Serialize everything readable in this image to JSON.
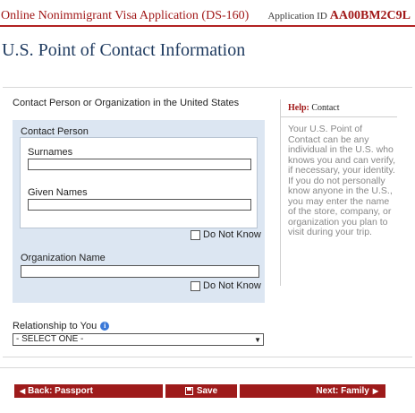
{
  "header": {
    "app_title": "Online Nonimmigrant Visa Application (DS-160)",
    "app_id_label": "Application ID",
    "app_id_value": "AA00BM2C9L"
  },
  "page": {
    "title": "U.S. Point of Contact Information"
  },
  "form": {
    "section_title": "Contact Person or Organization in the United States",
    "contact_person_legend": "Contact Person",
    "surnames_label": "Surnames",
    "surnames_value": "",
    "given_names_label": "Given Names",
    "given_names_value": "",
    "do_not_know_label": "Do Not Know",
    "organization_label": "Organization Name",
    "organization_value": "",
    "relationship_label": "Relationship to You",
    "relationship_selected": "- SELECT ONE -"
  },
  "help": {
    "heading": "Help:",
    "topic": "Contact",
    "text": "Your U.S. Point of Contact can be any individual in the U.S. who knows you and can verify, if necessary, your identity. If you do not personally know anyone in the U.S., you may enter the name of the store, company, or organization you plan to visit during your trip."
  },
  "nav": {
    "back_label": "Back: Passport",
    "save_label": "Save",
    "next_label": "Next: Family"
  },
  "colors": {
    "accent": "#9e1b1b",
    "title_blue": "#1e3a5f",
    "panel_blue": "#dce6f2"
  }
}
